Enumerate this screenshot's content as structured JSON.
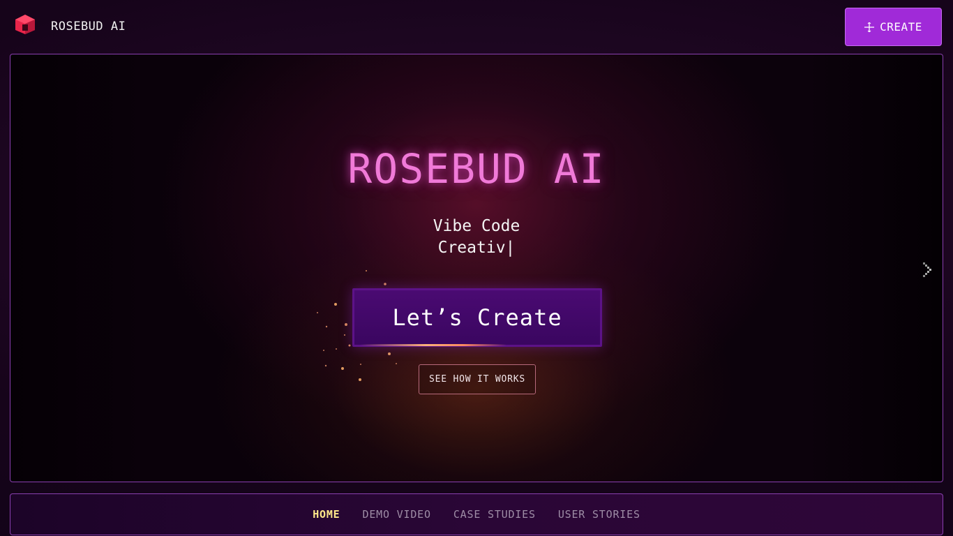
{
  "app": {
    "brand": "ROSEBUD AI",
    "logo_icon": "rosebud-cube-logo",
    "accent_color": "#a02ad8"
  },
  "header": {
    "create_label": "CREATE",
    "create_icon": "move-plus-icon"
  },
  "hero": {
    "title": "ROSEBUD AI",
    "subtitle_line1": "Vibe Code",
    "subtitle_line2": "Creativ|",
    "cta_label": "Let’s Create",
    "secondary_label": "SEE HOW IT WORKS",
    "next_icon": "chevron-right-icon",
    "title_color": "#f07ad8"
  },
  "nav": {
    "items": [
      {
        "label": "HOME",
        "active": true
      },
      {
        "label": "DEMO VIDEO",
        "active": false
      },
      {
        "label": "CASE STUDIES",
        "active": false
      },
      {
        "label": "USER STORIES",
        "active": false
      }
    ],
    "active_color": "#ffe88a"
  }
}
